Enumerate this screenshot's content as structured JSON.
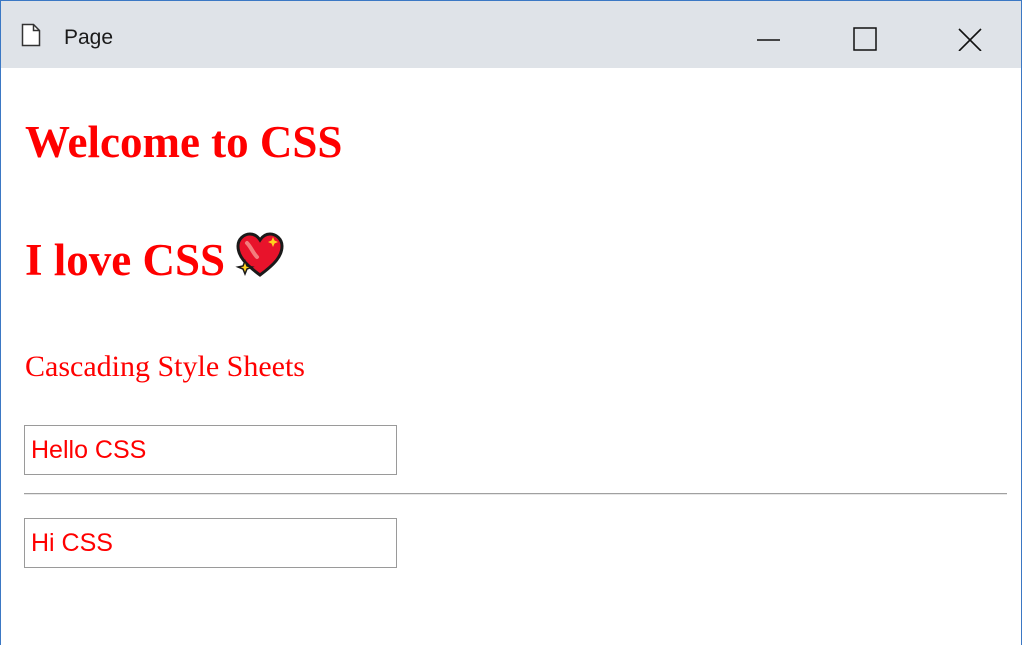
{
  "window": {
    "title": "Page",
    "icons": {
      "page": "page-icon",
      "minimize": "minimize-icon",
      "maximize": "maximize-icon",
      "close": "close-icon"
    }
  },
  "content": {
    "heading1": "Welcome to CSS",
    "heading2": "I love CSS",
    "heading2_emoji": "sparkling-heart-icon",
    "paragraph": "Cascading Style Sheets",
    "inputs": [
      {
        "value": "Hello CSS"
      },
      {
        "value": "Hi CSS"
      }
    ]
  },
  "colors": {
    "text_accent": "#ff0000",
    "titlebar_bg": "#dfe3e8",
    "window_border": "#3b78c4"
  }
}
